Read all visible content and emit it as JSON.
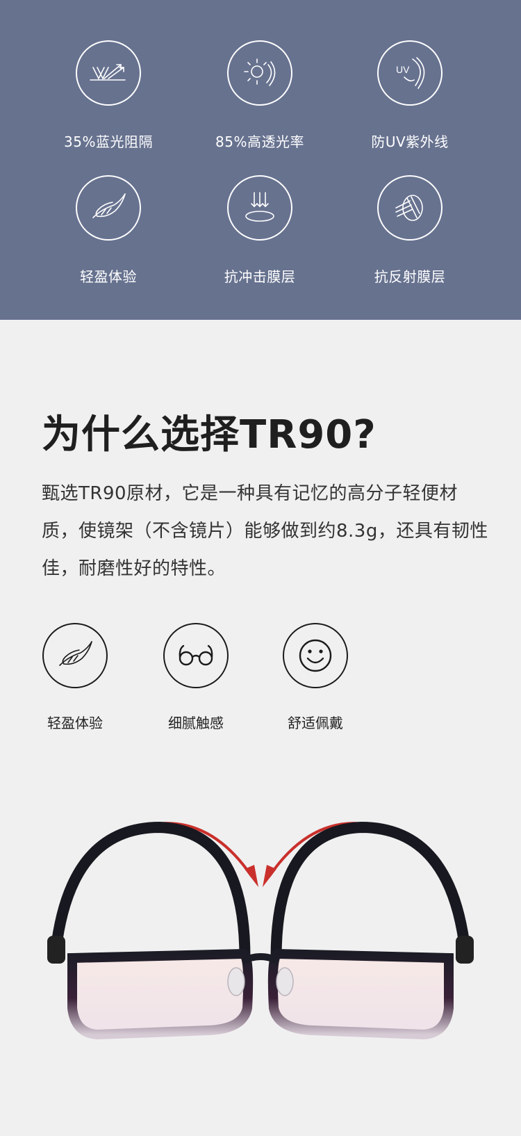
{
  "colors": {
    "band_bg": "#67728f",
    "page_bg": "#f0f0f0",
    "arrow_red": "#c9302c"
  },
  "features": [
    {
      "label": "35%蓝光阻隔",
      "icon": "blue-light-block-icon"
    },
    {
      "label": "85%高透光率",
      "icon": "sun-transmission-icon"
    },
    {
      "label": "防UV紫外线",
      "icon": "uv-shield-icon",
      "icon_text": "UV"
    },
    {
      "label": "轻盈体验",
      "icon": "feather-icon"
    },
    {
      "label": "抗冲击膜层",
      "icon": "impact-resist-icon"
    },
    {
      "label": "抗反射膜层",
      "icon": "anti-reflect-icon"
    }
  ],
  "why": {
    "title": "为什么选择TR90?",
    "body": "甄选TR90原材，它是一种具有记忆的高分子轻便材质，使镜架（不含镜片）能够做到约8.3g，还具有韧性佳，耐磨性好的特性。",
    "features": [
      {
        "label": "轻盈体验",
        "icon": "feather-icon"
      },
      {
        "label": "细腻触感",
        "icon": "glasses-icon"
      },
      {
        "label": "舒适佩戴",
        "icon": "smiley-icon"
      }
    ]
  }
}
